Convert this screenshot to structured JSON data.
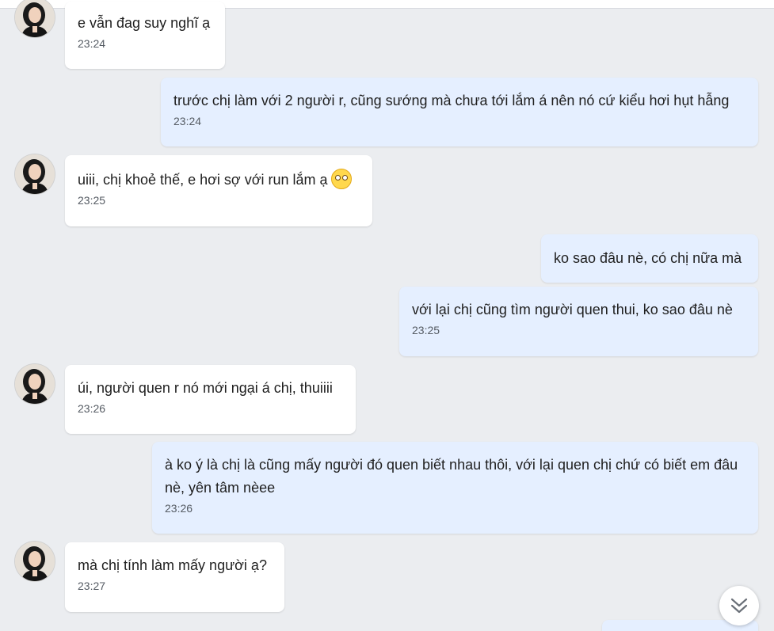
{
  "contact": {
    "avatar_icon": "contact-avatar-photo"
  },
  "messages": [
    {
      "direction": "incoming",
      "text": "e vẫn đag suy nghĩ ạ",
      "time": "23:24"
    },
    {
      "direction": "outgoing",
      "text": "trước chị làm với 2 người r, cũng sướng mà chưa tới lắm á nên nó cứ kiểu hơi hụt hẫng",
      "time": "23:24"
    },
    {
      "direction": "incoming",
      "text": "uiii, chị khoẻ thế, e hơi sợ với run lắm ạ",
      "emoji": "pleading-face-emoji",
      "time": "23:25"
    },
    {
      "direction": "outgoing",
      "text": "ko sao đâu nè, có chị nữa mà"
    },
    {
      "direction": "outgoing",
      "text": "với lại chị cũng tìm người quen thui, ko sao đâu nè",
      "time": "23:25"
    },
    {
      "direction": "incoming",
      "text": "úi, người quen r nó mới ngại á chị, thuiiii",
      "time": "23:26"
    },
    {
      "direction": "outgoing",
      "text": "à ko ý là chị là cũng mấy người đó quen biết nhau thôi, với lại quen chị chứ có biết em đâu nè, yên tâm nèee",
      "time": "23:26"
    },
    {
      "direction": "incoming",
      "text": "mà chị tính làm mấy người ạ?",
      "time": "23:27"
    }
  ],
  "scroll_button": {
    "icon": "double-chevron-down-icon"
  },
  "colors": {
    "background": "#ebedf0",
    "incoming_bubble": "#ffffff",
    "outgoing_bubble": "#e5efff",
    "timestamp": "#555b63"
  }
}
